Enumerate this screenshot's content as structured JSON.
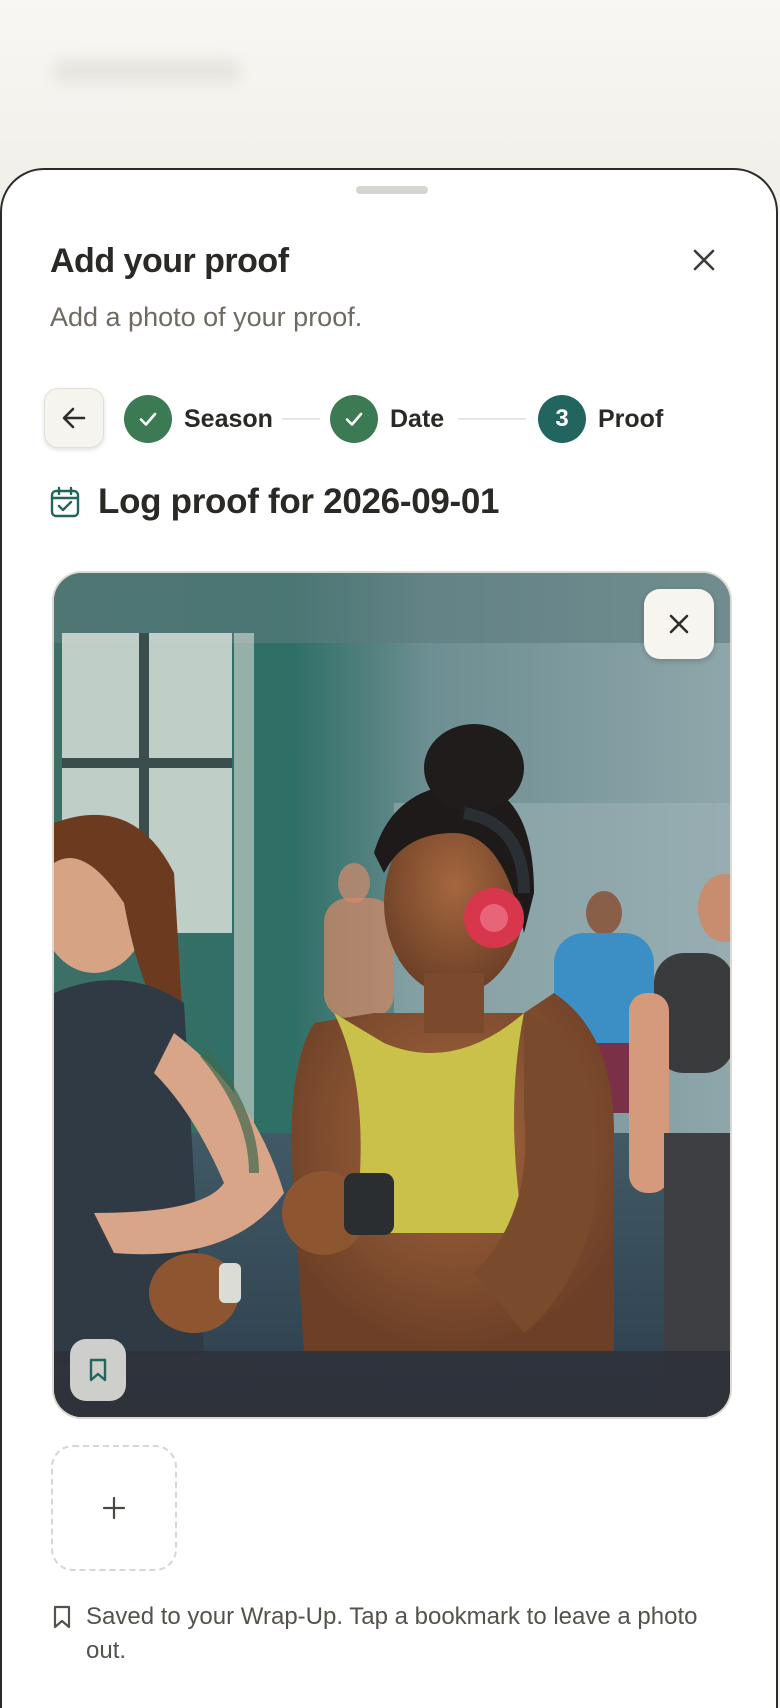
{
  "sheet": {
    "title": "Add your proof",
    "subtitle": "Add a photo of your proof.",
    "close_icon": "close-icon"
  },
  "stepper": {
    "back_icon": "arrow-left-icon",
    "steps": [
      {
        "label": "Season",
        "state": "done",
        "marker": "check-icon"
      },
      {
        "label": "Date",
        "state": "done",
        "marker": "check-icon"
      },
      {
        "label": "Proof",
        "state": "current",
        "marker": "3"
      }
    ]
  },
  "log": {
    "heading": "Log proof for 2026-09-01",
    "icon": "calendar-check-icon"
  },
  "photo": {
    "alt": "Workout photo",
    "remove_icon": "close-icon",
    "bookmark_icon": "bookmark-icon"
  },
  "add_photo": {
    "icon": "plus-icon"
  },
  "hint": {
    "icon": "bookmark-icon",
    "text": "Saved to your Wrap-Up. Tap a bookmark to leave a photo out."
  },
  "colors": {
    "done_step": "#3b7a52",
    "current_step": "#22655f",
    "accent": "#22655f"
  }
}
